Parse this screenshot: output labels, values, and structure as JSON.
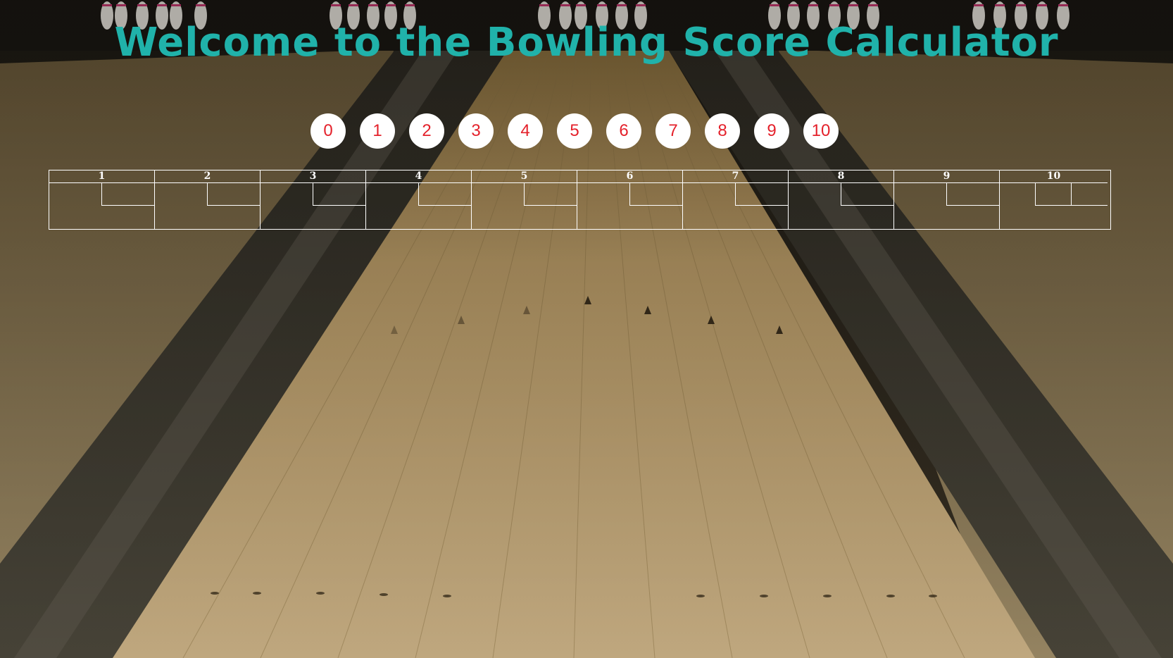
{
  "title": "Welcome to the Bowling Score Calculator",
  "pin_buttons": [
    "0",
    "1",
    "2",
    "3",
    "4",
    "5",
    "6",
    "7",
    "8",
    "9",
    "10"
  ],
  "frames": [
    {
      "number": "1",
      "rolls": [
        "",
        ""
      ],
      "total": ""
    },
    {
      "number": "2",
      "rolls": [
        "",
        ""
      ],
      "total": ""
    },
    {
      "number": "3",
      "rolls": [
        "",
        ""
      ],
      "total": ""
    },
    {
      "number": "4",
      "rolls": [
        "",
        ""
      ],
      "total": ""
    },
    {
      "number": "5",
      "rolls": [
        "",
        ""
      ],
      "total": ""
    },
    {
      "number": "6",
      "rolls": [
        "",
        ""
      ],
      "total": ""
    },
    {
      "number": "7",
      "rolls": [
        "",
        ""
      ],
      "total": ""
    },
    {
      "number": "8",
      "rolls": [
        "",
        ""
      ],
      "total": ""
    },
    {
      "number": "9",
      "rolls": [
        "",
        ""
      ],
      "total": ""
    },
    {
      "number": "10",
      "rolls": [
        "",
        "",
        ""
      ],
      "total": ""
    }
  ],
  "colors": {
    "title": "#20b2aa",
    "pin_button_bg": "#ffffff",
    "pin_button_text": "#e4212b",
    "scoreboard_lines": "#ffffff"
  },
  "background": "bowling-alley-image"
}
